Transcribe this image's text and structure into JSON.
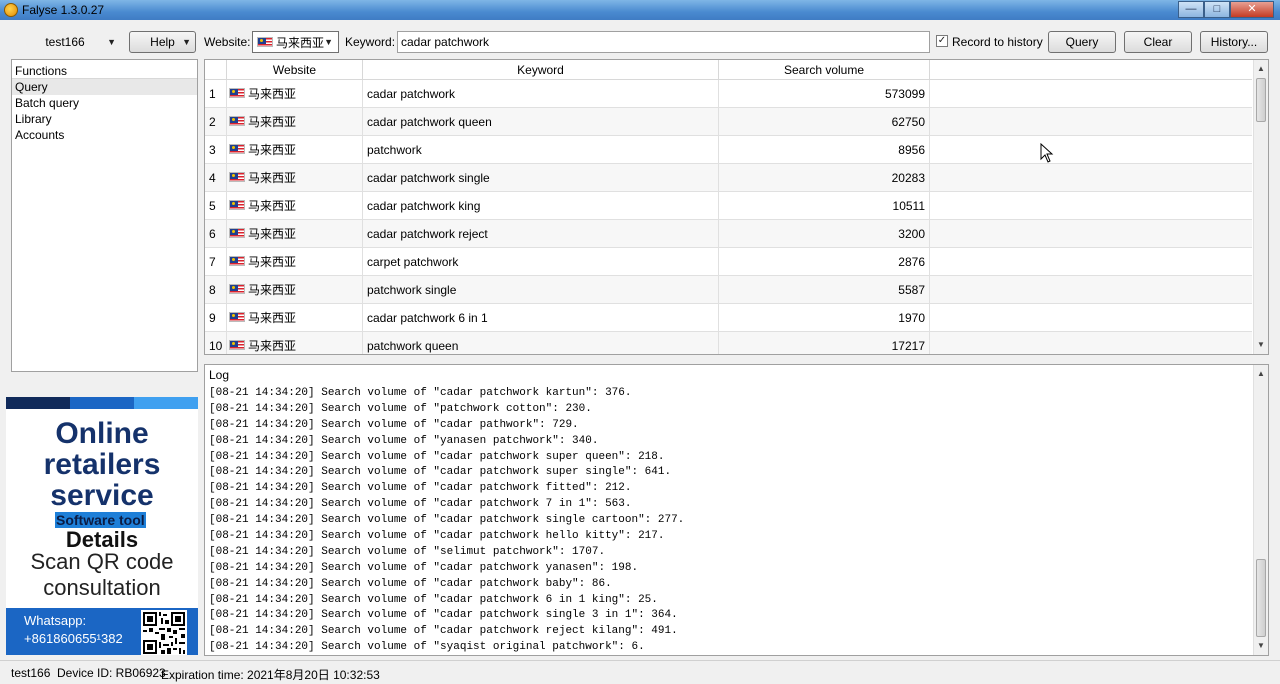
{
  "window": {
    "title": "Falyse 1.3.0.27"
  },
  "toolbar": {
    "user": "test166",
    "help_label": "Help",
    "website_label": "Website:",
    "website_value": "马来西亚",
    "keyword_label": "Keyword:",
    "keyword_value": "cadar patchwork",
    "record_label": "Record to history",
    "record_checked": true,
    "query_label": "Query",
    "clear_label": "Clear",
    "history_label": "History..."
  },
  "functions": {
    "header": "Functions",
    "items": [
      "Query",
      "Batch query",
      "Library",
      "Accounts"
    ],
    "selected": "Query"
  },
  "ad": {
    "line1": "Online",
    "line2": "retailers",
    "line3": "service",
    "software": "Software tool",
    "details": "Details",
    "scan1": "Scan QR code",
    "scan2": "consultation",
    "whatsapp": "Whatsapp:",
    "phone": "+861860655¹382"
  },
  "table": {
    "columns": [
      "Website",
      "Keyword",
      "Search volume"
    ],
    "rows": [
      {
        "idx": "1",
        "site": "马来西亚",
        "keyword": "cadar patchwork",
        "volume": "573099"
      },
      {
        "idx": "2",
        "site": "马来西亚",
        "keyword": "cadar patchwork queen",
        "volume": "62750"
      },
      {
        "idx": "3",
        "site": "马来西亚",
        "keyword": "patchwork",
        "volume": "8956"
      },
      {
        "idx": "4",
        "site": "马来西亚",
        "keyword": "cadar patchwork single",
        "volume": "20283"
      },
      {
        "idx": "5",
        "site": "马来西亚",
        "keyword": "cadar patchwork king",
        "volume": "10511"
      },
      {
        "idx": "6",
        "site": "马来西亚",
        "keyword": "cadar patchwork reject",
        "volume": "3200"
      },
      {
        "idx": "7",
        "site": "马来西亚",
        "keyword": "carpet patchwork",
        "volume": "2876"
      },
      {
        "idx": "8",
        "site": "马来西亚",
        "keyword": "patchwork single",
        "volume": "5587"
      },
      {
        "idx": "9",
        "site": "马来西亚",
        "keyword": "cadar patchwork 6 in 1",
        "volume": "1970"
      },
      {
        "idx": "10",
        "site": "马来西亚",
        "keyword": "patchwork queen",
        "volume": "17217"
      }
    ]
  },
  "log": {
    "header": "Log",
    "lines": [
      "[08-21 14:34:20] Search volume of \"cadar patchwork kartun\": 376.",
      "[08-21 14:34:20] Search volume of \"patchwork cotton\": 230.",
      "[08-21 14:34:20] Search volume of \"cadar pathwork\": 729.",
      "[08-21 14:34:20] Search volume of \"yanasen patchwork\": 340.",
      "[08-21 14:34:20] Search volume of \"cadar patchwork super queen\": 218.",
      "[08-21 14:34:20] Search volume of \"cadar patchwork super single\": 641.",
      "[08-21 14:34:20] Search volume of \"cadar patchwork fitted\": 212.",
      "[08-21 14:34:20] Search volume of \"cadar patchwork 7 in 1\": 563.",
      "[08-21 14:34:20] Search volume of \"cadar patchwork single cartoon\": 277.",
      "[08-21 14:34:20] Search volume of \"cadar patchwork hello kitty\": 217.",
      "[08-21 14:34:20] Search volume of \"selimut patchwork\": 1707.",
      "[08-21 14:34:20] Search volume of \"cadar patchwork yanasen\": 198.",
      "[08-21 14:34:20] Search volume of \"cadar patchwork baby\": 86.",
      "[08-21 14:34:20] Search volume of \"cadar patchwork 6 in 1 king\": 25.",
      "[08-21 14:34:20] Search volume of \"cadar patchwork single 3 in 1\": 364.",
      "[08-21 14:34:20] Search volume of \"cadar patchwork reject kilang\": 491.",
      "[08-21 14:34:20] Search volume of \"syaqist original patchwork\": 6."
    ]
  },
  "status": {
    "user": "test166",
    "device": "Device ID: RB06923",
    "expiration": "Expiration time: 2021年8月20日 10:32:53"
  },
  "colors": {
    "title_bar": "#4a8ad0",
    "ad_navy": "#15326b",
    "ad_blue": "#1b66c4",
    "close_red": "#c43b23"
  }
}
